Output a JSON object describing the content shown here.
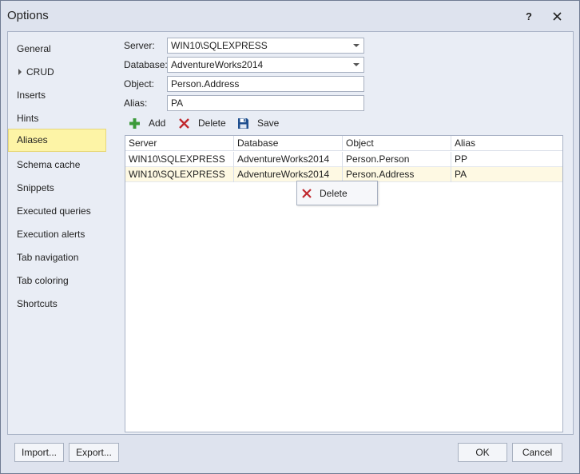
{
  "window": {
    "title": "Options",
    "help_label": "?"
  },
  "nav": {
    "items": [
      {
        "label": "General"
      },
      {
        "label": "CRUD",
        "expandable": true
      },
      {
        "label": "Inserts"
      },
      {
        "label": "Hints"
      },
      {
        "label": "Aliases",
        "active": true
      },
      {
        "label": "Schema cache"
      },
      {
        "label": "Snippets"
      },
      {
        "label": "Executed queries"
      },
      {
        "label": "Execution alerts"
      },
      {
        "label": "Tab navigation"
      },
      {
        "label": "Tab coloring"
      },
      {
        "label": "Shortcuts"
      }
    ]
  },
  "form": {
    "server": {
      "label": "Server:",
      "value": "WIN10\\SQLEXPRESS"
    },
    "database": {
      "label": "Database:",
      "value": "AdventureWorks2014"
    },
    "object": {
      "label": "Object:",
      "value": "Person.Address"
    },
    "alias": {
      "label": "Alias:",
      "value": "PA"
    }
  },
  "toolbar": {
    "add_label": "Add",
    "delete_label": "Delete",
    "save_label": "Save"
  },
  "grid": {
    "columns": [
      "Server",
      "Database",
      "Object",
      "Alias"
    ],
    "rows": [
      [
        "WIN10\\SQLEXPRESS",
        "AdventureWorks2014",
        "Person.Person",
        "PP"
      ],
      [
        "WIN10\\SQLEXPRESS",
        "AdventureWorks2014",
        "Person.Address",
        "PA"
      ]
    ]
  },
  "context_menu": {
    "delete_label": "Delete"
  },
  "footer": {
    "import_label": "Import...",
    "export_label": "Export...",
    "ok_label": "OK",
    "cancel_label": "Cancel"
  },
  "colors": {
    "accent_selected": "#fdf4a6",
    "delete_red": "#c0282d",
    "add_green": "#3c9a3a",
    "save_blue": "#1f4f8f"
  }
}
